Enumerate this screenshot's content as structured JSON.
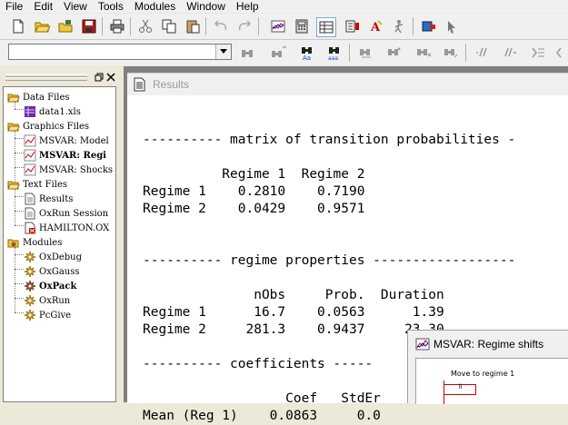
{
  "menu": [
    "File",
    "Edit",
    "View",
    "Tools",
    "Modules",
    "Window",
    "Help"
  ],
  "sidebar": {
    "items": [
      {
        "label": "Data Files",
        "kind": "folder"
      },
      {
        "label": "data1.xls",
        "kind": "data-file"
      },
      {
        "label": "Graphics Files",
        "kind": "folder"
      },
      {
        "label": "MSVAR: Model",
        "kind": "graph-file"
      },
      {
        "label": "MSVAR: Regi",
        "kind": "graph-file"
      },
      {
        "label": "MSVAR: Shocks",
        "kind": "graph-file"
      },
      {
        "label": "Text Files",
        "kind": "folder"
      },
      {
        "label": "Results",
        "kind": "text-file"
      },
      {
        "label": "OxRun Session",
        "kind": "text-file"
      },
      {
        "label": "HAMILTON.OX",
        "kind": "ox-file"
      },
      {
        "label": "Modules",
        "kind": "folder"
      },
      {
        "label": "OxDebug",
        "kind": "module"
      },
      {
        "label": "OxGauss",
        "kind": "module"
      },
      {
        "label": "OxPack",
        "kind": "module"
      },
      {
        "label": "OxRun",
        "kind": "module"
      },
      {
        "label": "PcGive",
        "kind": "module"
      }
    ]
  },
  "document": {
    "title": "Results",
    "lines": [
      "",
      "---------- matrix of transition probabilities -",
      "",
      "          Regime 1  Regime 2",
      "Regime 1    0.2810    0.7190",
      "Regime 2    0.0429    0.9571",
      "",
      "",
      "---------- regime properties ------------------",
      "",
      "              nObs     Prob.  Duration",
      "Regime 1      16.7    0.0563      1.39",
      "Regime 2     281.3    0.9437     23.30",
      "",
      "---------- coefficients -----",
      "",
      "                  Coef   StdEr",
      "Mean (Reg 1)    0.0863     0.0"
    ]
  },
  "popup": {
    "title": "MSVAR: Regime shifts",
    "graph_label": "Move to regime 1",
    "legend_label": "ll"
  }
}
